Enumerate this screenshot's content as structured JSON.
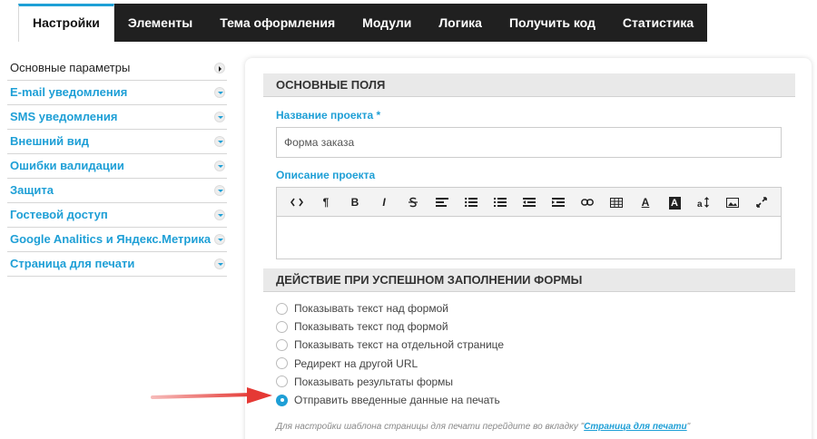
{
  "tabs": [
    "Настройки",
    "Элементы",
    "Тема оформления",
    "Модули",
    "Логика",
    "Получить код",
    "Статистика"
  ],
  "sidebar": {
    "items": [
      {
        "label": "Основные параметры"
      },
      {
        "label": "E-mail уведомления"
      },
      {
        "label": "SMS уведомления"
      },
      {
        "label": "Внешний вид"
      },
      {
        "label": "Ошибки валидации"
      },
      {
        "label": "Защита"
      },
      {
        "label": "Гостевой доступ"
      },
      {
        "label": "Google Analitics и Яндекс.Метрика"
      },
      {
        "label": "Страница для печати"
      }
    ]
  },
  "main": {
    "section1_title": "Основные поля",
    "project_name_label": "Название проекта *",
    "project_name_value": "Форма заказа",
    "project_desc_label": "Описание проекта",
    "toolbar": [
      "code-icon",
      "paragraph-icon",
      "bold-icon",
      "italic-icon",
      "strikethrough-icon",
      "align-left-icon",
      "unordered-list-icon",
      "ordered-list-icon",
      "outdent-icon",
      "indent-icon",
      "link-icon",
      "table-icon",
      "font-color-icon",
      "highlight-icon",
      "font-size-icon",
      "image-icon",
      "fullscreen-icon"
    ],
    "toolbar_text": {
      "paragraph": "¶",
      "bold": "B",
      "italic": "I",
      "font_color": "A",
      "highlight": "A"
    },
    "section2_title": "Действие при успешном заполнении формы",
    "radios": [
      {
        "label": "Показывать текст над формой",
        "checked": false
      },
      {
        "label": "Показывать текст под формой",
        "checked": false
      },
      {
        "label": "Показывать текст на отдельной странице",
        "checked": false
      },
      {
        "label": "Редирект на другой URL",
        "checked": false
      },
      {
        "label": "Показывать результаты формы",
        "checked": false
      },
      {
        "label": "Отправить введенные данные на печать",
        "checked": true
      }
    ],
    "hint_prefix": "Для настройки шаблона страницы для печати перейдите во вкладку \"",
    "hint_link": "Страница для печати",
    "hint_suffix": "\""
  },
  "colors": {
    "accent": "#1e9fd6",
    "tabbar": "#202020",
    "arrow": "#e53935"
  }
}
